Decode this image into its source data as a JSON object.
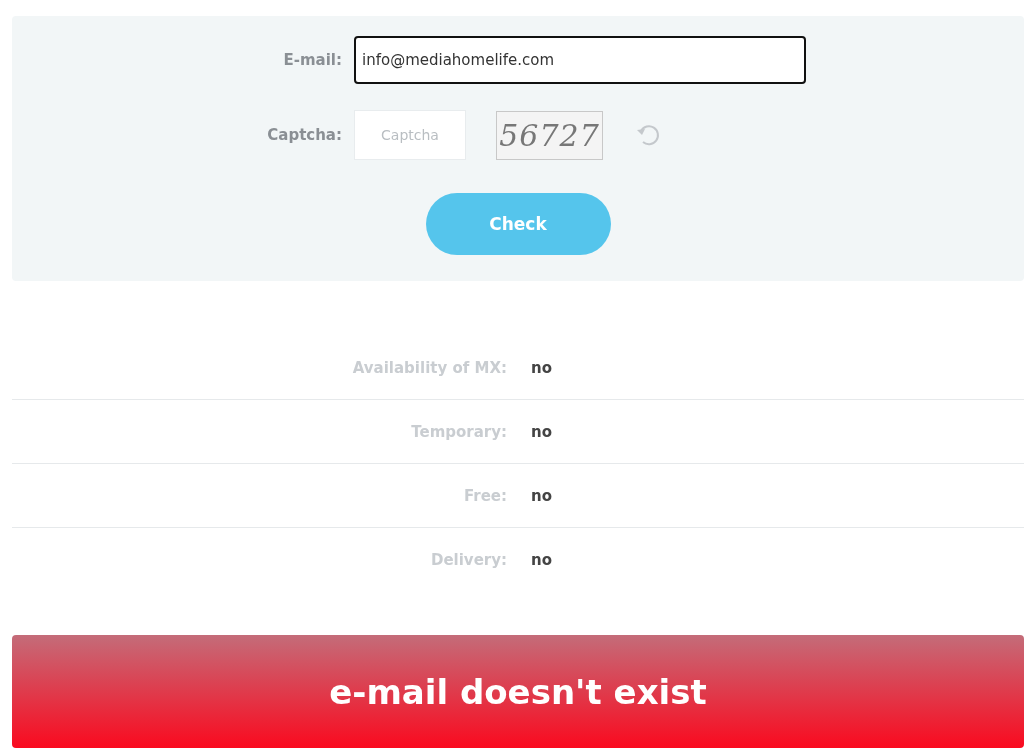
{
  "form": {
    "email": {
      "label": "E-mail:",
      "value": "info@mediahomelife.com",
      "focused": true
    },
    "captcha": {
      "label": "Captcha:",
      "placeholder": "Captcha",
      "image_text": "56727"
    },
    "button": "Check"
  },
  "results": [
    {
      "label": "Availability of MX:",
      "value": "no"
    },
    {
      "label": "Temporary:",
      "value": "no"
    },
    {
      "label": "Free:",
      "value": "no"
    },
    {
      "label": "Delivery:",
      "value": "no"
    }
  ],
  "verdict": {
    "text": "e-mail doesn't exist",
    "kind": "error"
  }
}
